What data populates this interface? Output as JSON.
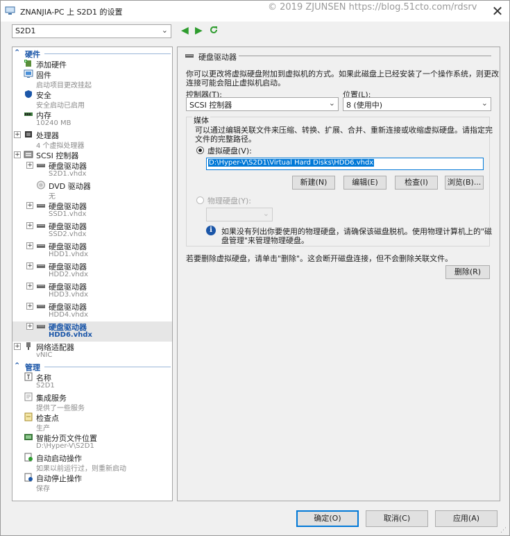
{
  "window": {
    "title": "ZNANJIA-PC 上 S2D1 的设置",
    "watermark": "© 2019 ZJUNSEN https://blog.51cto.com/rdsrv",
    "close": "✕"
  },
  "vm_selector": {
    "value": "S2D1"
  },
  "tree": {
    "hardware_section": "硬件",
    "management_section": "管理",
    "hardware_items": [
      {
        "label": "添加硬件",
        "sub": "",
        "icon": "add-hardware-icon"
      },
      {
        "label": "固件",
        "sub": "启动项目更改挂起",
        "icon": "firmware-icon"
      },
      {
        "label": "安全",
        "sub": "安全启动已启用",
        "icon": "shield-icon"
      },
      {
        "label": "内存",
        "sub": "10240 MB",
        "icon": "memory-icon"
      },
      {
        "label": "处理器",
        "sub": "4 个虚拟处理器",
        "icon": "cpu-icon"
      },
      {
        "label": "SCSI 控制器",
        "sub": "",
        "icon": "scsi-controller-icon"
      }
    ],
    "scsi_children": [
      {
        "label": "硬盘驱动器",
        "sub": "S2D1.vhdx",
        "icon": "hard-drive-icon"
      },
      {
        "label": "DVD 驱动器",
        "sub": "无",
        "icon": "dvd-icon"
      },
      {
        "label": "硬盘驱动器",
        "sub": "SSD1.vhdx",
        "icon": "hard-drive-icon"
      },
      {
        "label": "硬盘驱动器",
        "sub": "SSD2.vhdx",
        "icon": "hard-drive-icon"
      },
      {
        "label": "硬盘驱动器",
        "sub": "HDD1.vhdx",
        "icon": "hard-drive-icon"
      },
      {
        "label": "硬盘驱动器",
        "sub": "HDD2.vhdx",
        "icon": "hard-drive-icon"
      },
      {
        "label": "硬盘驱动器",
        "sub": "HDD3.vhdx",
        "icon": "hard-drive-icon"
      },
      {
        "label": "硬盘驱动器",
        "sub": "HDD4.vhdx",
        "icon": "hard-drive-icon"
      },
      {
        "label": "硬盘驱动器",
        "sub": "HDD6.vhdx",
        "icon": "hard-drive-icon",
        "selected": true
      }
    ],
    "network": {
      "label": "网络适配器",
      "sub": "vNIC",
      "icon": "network-adapter-icon"
    },
    "management_items": [
      {
        "label": "名称",
        "sub": "S2D1",
        "icon": "name-icon"
      },
      {
        "label": "集成服务",
        "sub": "提供了一些服务",
        "icon": "integration-services-icon"
      },
      {
        "label": "检查点",
        "sub": "生产",
        "icon": "checkpoint-icon"
      },
      {
        "label": "智能分页文件位置",
        "sub": "D:\\Hyper-V\\S2D1",
        "icon": "paging-file-icon"
      },
      {
        "label": "自动启动操作",
        "sub": "如果以前运行过，则重新启动",
        "icon": "auto-start-icon"
      },
      {
        "label": "自动停止操作",
        "sub": "保存",
        "icon": "auto-stop-icon"
      }
    ]
  },
  "details": {
    "header": "硬盘驱动器",
    "description": [
      "你可以更改将虚拟硬盘附加到虚拟机的方式。如果此磁盘上已经安装了一个操作系统，则更改",
      "连接可能会阻止虚拟机启动。"
    ],
    "controller_label": "控制器(T):",
    "controller_value": "SCSI 控制器",
    "location_label": "位置(L):",
    "location_value": "8 (使用中)",
    "media_label": "媒体",
    "media_desc": [
      "可以通过编辑关联文件来压缩、转换、扩展、合并、重新连接或收缩虚拟硬盘。请指定完",
      "文件的完整路径。"
    ],
    "vhd_radio": "虚拟硬盘(V):",
    "vhd_path": "D:\\Hyper-V\\S2D1\\Virtual Hard Disks\\HDD6.vhdx",
    "buttons": {
      "new": "新建(N)",
      "edit": "编辑(E)",
      "inspect": "检查(I)",
      "browse": "浏览(B)..."
    },
    "physical_radio": "物理硬盘(Y):",
    "info_text": [
      "如果没有列出你要使用的物理硬盘，请确保该磁盘脱机。使用物理计算机上的\"磁",
      "盘管理\"来管理物理硬盘。"
    ],
    "remove_text": "若要删除虚拟硬盘，请单击\"删除\"。这会断开磁盘连接，但不会删除关联文件。",
    "remove_button": "删除(R)"
  },
  "footer": {
    "ok": "确定(O)",
    "cancel": "取消(C)",
    "apply": "应用(A)"
  }
}
